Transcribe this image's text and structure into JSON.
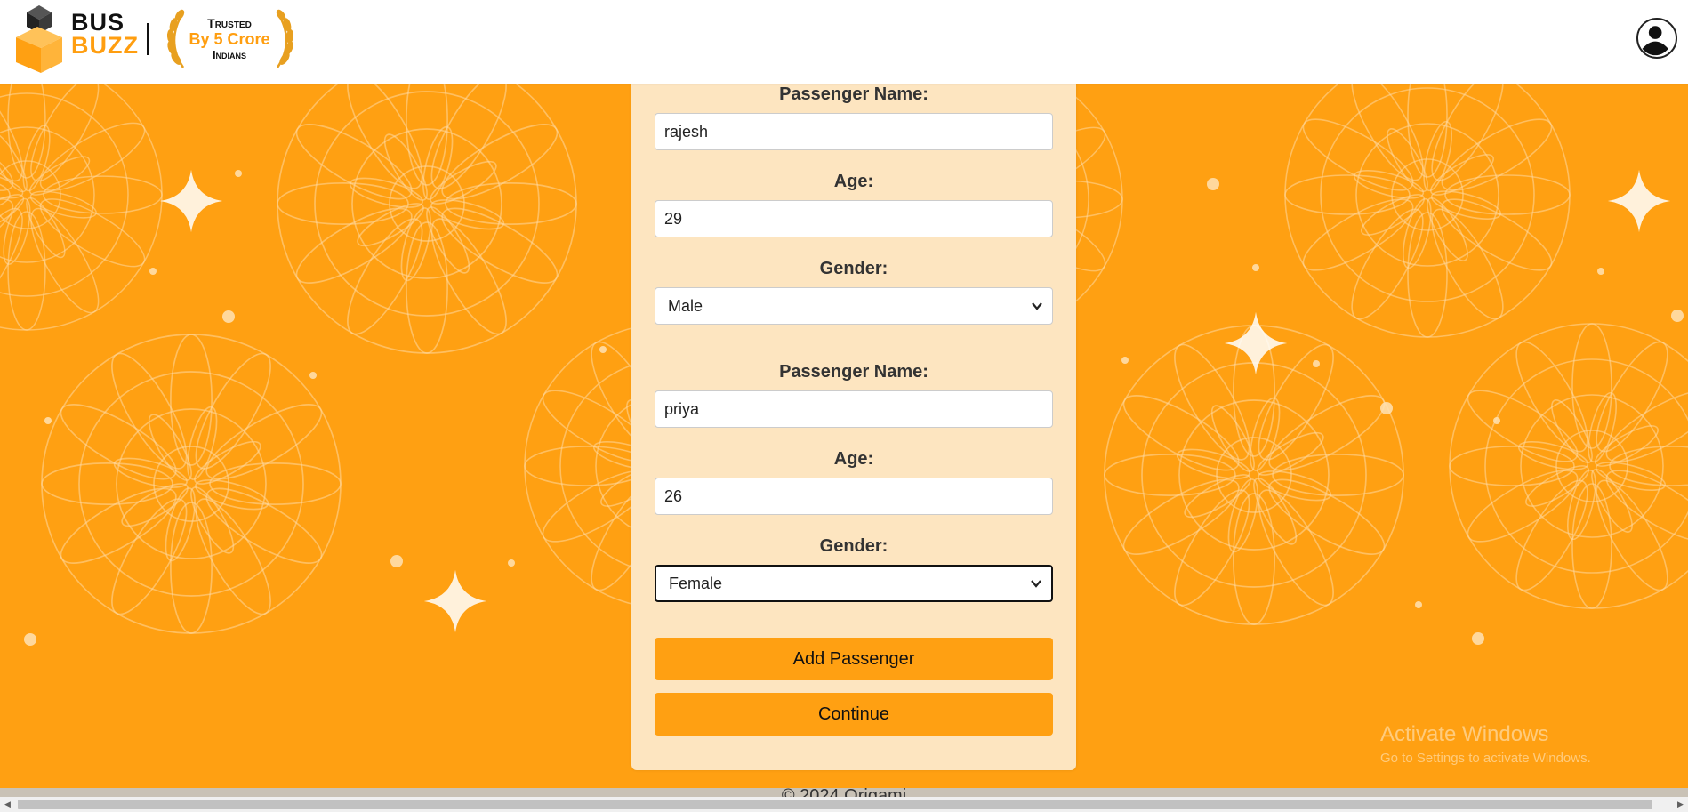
{
  "header": {
    "brand_line1": "BUS",
    "brand_line2": "BUZZ",
    "trust_line1": "Trusted",
    "trust_line2": "By 5 Crore",
    "trust_line3": "Indians",
    "avatar_icon": "user-avatar-icon"
  },
  "form": {
    "passengers": [
      {
        "name_label": "Passenger Name:",
        "name_value": "rajesh",
        "age_label": "Age:",
        "age_value": "29",
        "gender_label": "Gender:",
        "gender_value": "Male"
      },
      {
        "name_label": "Passenger Name:",
        "name_value": "priya",
        "age_label": "Age:",
        "age_value": "26",
        "gender_label": "Gender:",
        "gender_value": "Female"
      }
    ],
    "add_passenger_label": "Add Passenger",
    "continue_label": "Continue"
  },
  "footer": {
    "text": "© 2024 Origami"
  },
  "watermark": {
    "line1": "Activate Windows",
    "line2": "Go to Settings to activate Windows."
  },
  "colors": {
    "accent": "#ffa012",
    "card": "#fde5c0"
  }
}
